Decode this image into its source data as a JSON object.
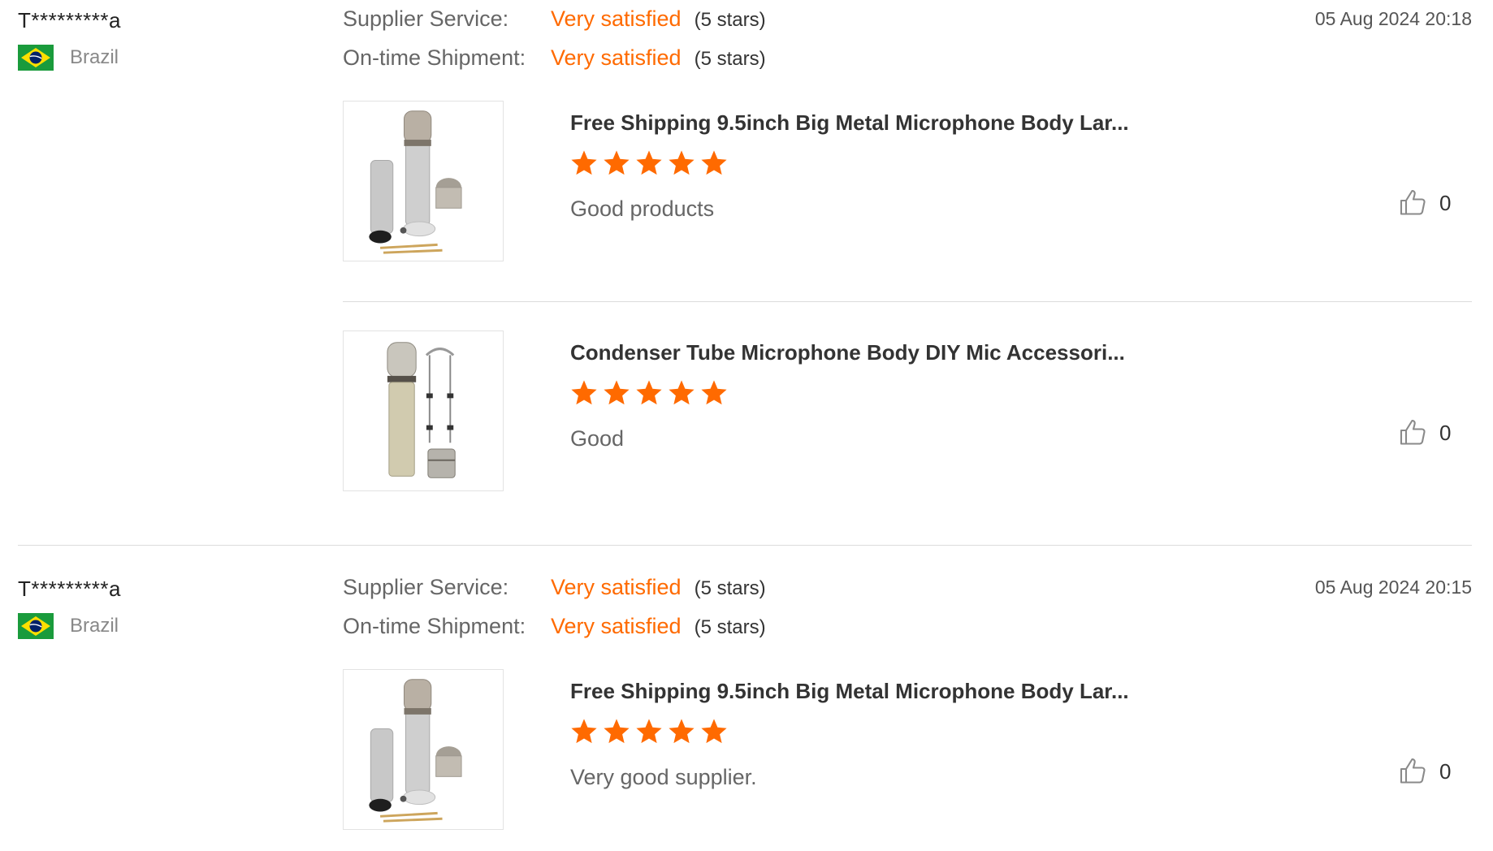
{
  "colors": {
    "accent": "#ff6a00",
    "divider": "#dcdcdc"
  },
  "reviews": [
    {
      "user": "T*********a",
      "country": "Brazil",
      "date": "05 Aug 2024 20:18",
      "supplier_service": {
        "label": "Supplier Service:",
        "value": "Very satisfied",
        "stars": "(5 stars)"
      },
      "shipment": {
        "label": "On-time Shipment:",
        "value": "Very satisfied",
        "stars": "(5 stars)"
      },
      "products": [
        {
          "title": "Free Shipping 9.5inch Big Metal Microphone Body Lar...",
          "rating": 5,
          "comment": "Good products",
          "likes": "0",
          "image_icon": "microphone-parts-image"
        },
        {
          "title": "Condenser Tube Microphone Body DIY Mic Accessori...",
          "rating": 5,
          "comment": "Good",
          "likes": "0",
          "image_icon": "microphone-tube-image"
        }
      ]
    },
    {
      "user": "T*********a",
      "country": "Brazil",
      "date": "05 Aug 2024 20:15",
      "supplier_service": {
        "label": "Supplier Service:",
        "value": "Very satisfied",
        "stars": "(5 stars)"
      },
      "shipment": {
        "label": "On-time Shipment:",
        "value": "Very satisfied",
        "stars": "(5 stars)"
      },
      "products": [
        {
          "title": "Free Shipping 9.5inch Big Metal Microphone Body Lar...",
          "rating": 5,
          "comment": "Very good supplier.",
          "likes": "0",
          "image_icon": "microphone-parts-image"
        }
      ]
    }
  ]
}
